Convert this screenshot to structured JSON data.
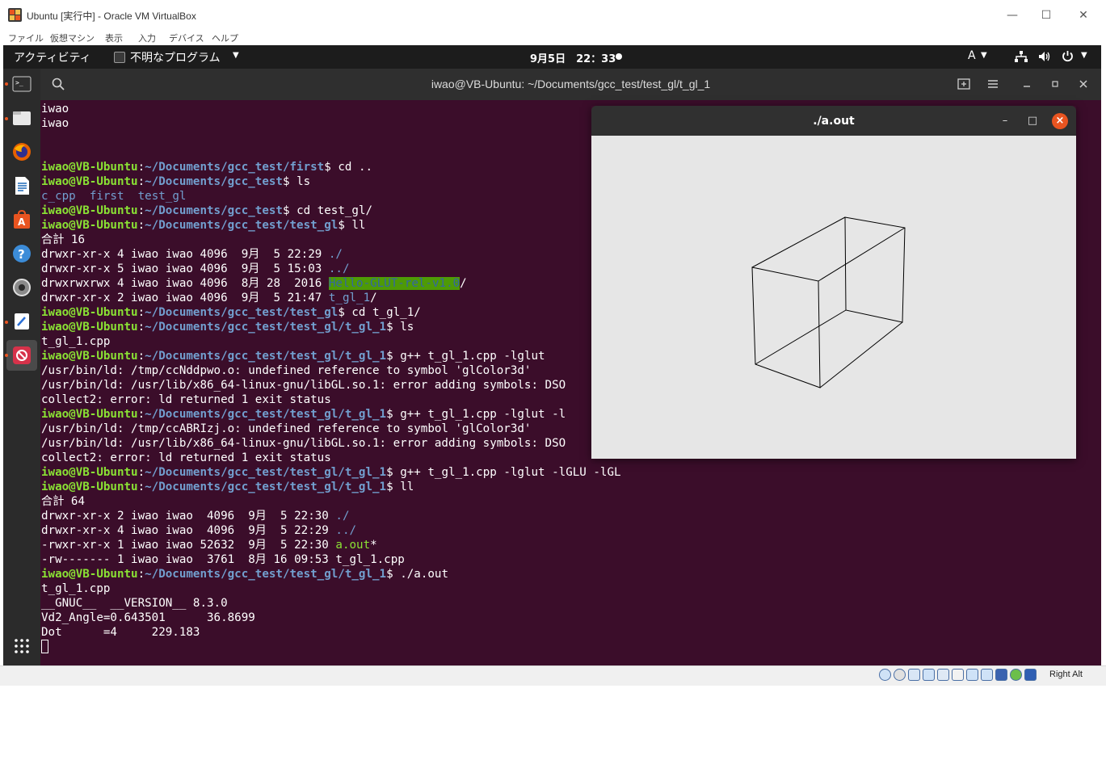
{
  "vbox": {
    "title": "Ubuntu [実行中] - Oracle VM VirtualBox",
    "window_buttons": {
      "minimize": "—",
      "maximize": "☐",
      "close": "✕"
    },
    "menu": [
      "ファイル",
      "仮想マシン",
      "表示",
      "入力",
      "デバイス",
      "ヘルプ"
    ],
    "status_host_key": "Right Alt"
  },
  "topbar": {
    "activities": "アクティビティ",
    "app_name": "不明なプログラム",
    "caret": "▼",
    "clock": "9月5日　22：33",
    "input_method": "A",
    "network_glyph": "品",
    "volume_glyph": "🔊",
    "power_glyph": "⏻"
  },
  "dock": {
    "items": [
      "terminal-icon",
      "files-icon",
      "firefox-icon",
      "writer-icon",
      "software-icon",
      "help-icon",
      "settings-icon",
      "text-editor-icon",
      "blocked-app-icon"
    ],
    "show_apps": "show-applications-icon"
  },
  "terminal": {
    "title": "iwao@VB-Ubuntu: ~/Documents/gcc_test/test_gl/t_gl_1",
    "prompt_user": "iwao@VB-Ubuntu",
    "lines": [
      [
        {
          "t": "iwao"
        }
      ],
      [
        {
          "t": "iwao"
        }
      ],
      [],
      [],
      [
        {
          "t": "iwao@VB-Ubuntu",
          "c": "p-user"
        },
        {
          "t": ":"
        },
        {
          "t": "~/Documents/gcc_test/first",
          "c": "p-path"
        },
        {
          "t": "$ cd .."
        }
      ],
      [
        {
          "t": "iwao@VB-Ubuntu",
          "c": "p-user"
        },
        {
          "t": ":"
        },
        {
          "t": "~/Documents/gcc_test",
          "c": "p-path"
        },
        {
          "t": "$ ls"
        }
      ],
      [
        {
          "t": "c_cpp",
          "c": "c-dir"
        },
        {
          "t": "  "
        },
        {
          "t": "first",
          "c": "c-dir"
        },
        {
          "t": "  "
        },
        {
          "t": "test_gl",
          "c": "c-dir"
        }
      ],
      [
        {
          "t": "iwao@VB-Ubuntu",
          "c": "p-user"
        },
        {
          "t": ":"
        },
        {
          "t": "~/Documents/gcc_test",
          "c": "p-path"
        },
        {
          "t": "$ cd test_gl/"
        }
      ],
      [
        {
          "t": "iwao@VB-Ubuntu",
          "c": "p-user"
        },
        {
          "t": ":"
        },
        {
          "t": "~/Documents/gcc_test/test_gl",
          "c": "p-path"
        },
        {
          "t": "$ ll"
        }
      ],
      [
        {
          "t": "合計 16"
        }
      ],
      [
        {
          "t": "drwxr-xr-x 4 iwao iwao 4096  9月  5 22:29 "
        },
        {
          "t": "./",
          "c": "c-dir"
        }
      ],
      [
        {
          "t": "drwxr-xr-x 5 iwao iwao 4096  9月  5 15:03 "
        },
        {
          "t": "../",
          "c": "c-dir"
        }
      ],
      [
        {
          "t": "drwxrwxrwx 4 iwao iwao 4096  8月 28  2016 "
        },
        {
          "t": "Hello-GLUT-rel-v1.0",
          "c": "c-hl"
        },
        {
          "t": "/"
        }
      ],
      [
        {
          "t": "drwxr-xr-x 2 iwao iwao 4096  9月  5 21:47 "
        },
        {
          "t": "t_gl_1",
          "c": "c-dir"
        },
        {
          "t": "/"
        }
      ],
      [
        {
          "t": "iwao@VB-Ubuntu",
          "c": "p-user"
        },
        {
          "t": ":"
        },
        {
          "t": "~/Documents/gcc_test/test_gl",
          "c": "p-path"
        },
        {
          "t": "$ cd t_gl_1/"
        }
      ],
      [
        {
          "t": "iwao@VB-Ubuntu",
          "c": "p-user"
        },
        {
          "t": ":"
        },
        {
          "t": "~/Documents/gcc_test/test_gl/t_gl_1",
          "c": "p-path"
        },
        {
          "t": "$ ls"
        }
      ],
      [
        {
          "t": "t_gl_1.cpp"
        }
      ],
      [
        {
          "t": "iwao@VB-Ubuntu",
          "c": "p-user"
        },
        {
          "t": ":"
        },
        {
          "t": "~/Documents/gcc_test/test_gl/t_gl_1",
          "c": "p-path"
        },
        {
          "t": "$ g++ t_gl_1.cpp -lglut"
        }
      ],
      [
        {
          "t": "/usr/bin/ld: /tmp/ccNddpwo.o: undefined reference to symbol 'glColor3d'"
        }
      ],
      [
        {
          "t": "/usr/bin/ld: /usr/lib/x86_64-linux-gnu/libGL.so.1: error adding symbols: DSO"
        }
      ],
      [
        {
          "t": "collect2: error: ld returned 1 exit status"
        }
      ],
      [
        {
          "t": "iwao@VB-Ubuntu",
          "c": "p-user"
        },
        {
          "t": ":"
        },
        {
          "t": "~/Documents/gcc_test/test_gl/t_gl_1",
          "c": "p-path"
        },
        {
          "t": "$ g++ t_gl_1.cpp -lglut -l"
        }
      ],
      [
        {
          "t": "/usr/bin/ld: /tmp/ccABRIzj.o: undefined reference to symbol 'glColor3d'"
        }
      ],
      [
        {
          "t": "/usr/bin/ld: /usr/lib/x86_64-linux-gnu/libGL.so.1: error adding symbols: DSO"
        }
      ],
      [
        {
          "t": "collect2: error: ld returned 1 exit status"
        }
      ],
      [
        {
          "t": "iwao@VB-Ubuntu",
          "c": "p-user"
        },
        {
          "t": ":"
        },
        {
          "t": "~/Documents/gcc_test/test_gl/t_gl_1",
          "c": "p-path"
        },
        {
          "t": "$ g++ t_gl_1.cpp -lglut -lGLU -lGL"
        }
      ],
      [
        {
          "t": "iwao@VB-Ubuntu",
          "c": "p-user"
        },
        {
          "t": ":"
        },
        {
          "t": "~/Documents/gcc_test/test_gl/t_gl_1",
          "c": "p-path"
        },
        {
          "t": "$ ll"
        }
      ],
      [
        {
          "t": "合計 64"
        }
      ],
      [
        {
          "t": "drwxr-xr-x 2 iwao iwao  4096  9月  5 22:30 "
        },
        {
          "t": "./",
          "c": "c-dir"
        }
      ],
      [
        {
          "t": "drwxr-xr-x 4 iwao iwao  4096  9月  5 22:29 "
        },
        {
          "t": "../",
          "c": "c-dir"
        }
      ],
      [
        {
          "t": "-rwxr-xr-x 1 iwao iwao 52632  9月  5 22:30 "
        },
        {
          "t": "a.out",
          "c": "c-exe"
        },
        {
          "t": "*"
        }
      ],
      [
        {
          "t": "-rw------- 1 iwao iwao  3761  8月 16 09:53 t_gl_1.cpp"
        }
      ],
      [
        {
          "t": "iwao@VB-Ubuntu",
          "c": "p-user"
        },
        {
          "t": ":"
        },
        {
          "t": "~/Documents/gcc_test/test_gl/t_gl_1",
          "c": "p-path"
        },
        {
          "t": "$ ./a.out"
        }
      ],
      [
        {
          "t": "t_gl_1.cpp"
        }
      ],
      [
        {
          "t": "__GNUC__  __VERSION__ 8.3.0"
        }
      ],
      [
        {
          "t": "Vd2_Angle=0.643501      36.8699"
        }
      ],
      [
        {
          "t": "Dot      =4     229.183"
        }
      ],
      [
        {
          "cursor": true
        }
      ]
    ]
  },
  "glut_window": {
    "title": "./a.out",
    "buttons": {
      "minimize": "–",
      "maximize": "□",
      "close": "×"
    },
    "canvas_color": "#e6e6e6"
  },
  "colors": {
    "terminal_bg": "#3b0d2a",
    "prompt_user": "#8ae234",
    "prompt_path": "#729fcf",
    "accent": "#e95420"
  }
}
